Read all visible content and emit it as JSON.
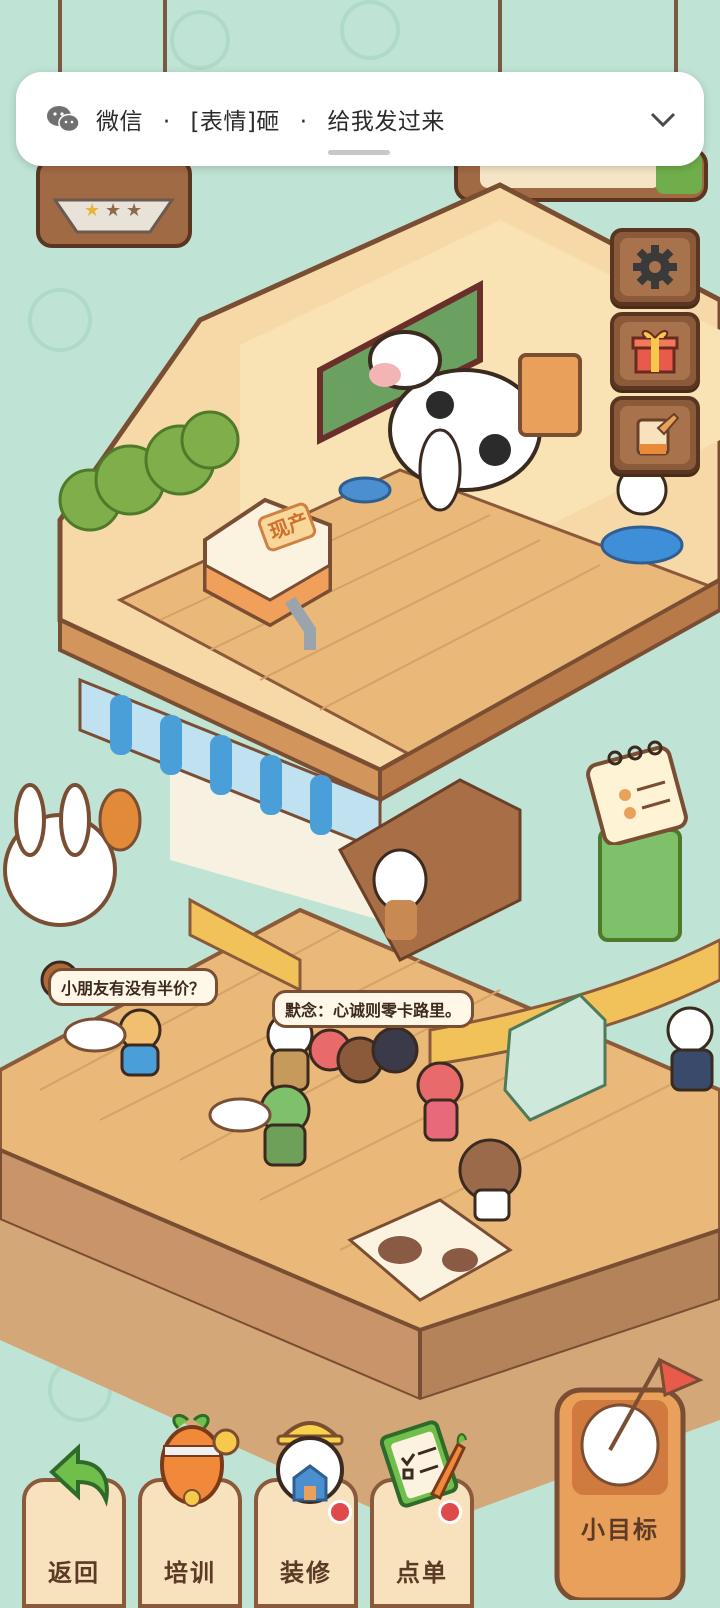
{
  "notification": {
    "app": "微信",
    "separator": "·",
    "sender": "[表情]砸",
    "message": "给我发过来"
  },
  "speech_bubbles": {
    "customer_left": "小朋友有没有半价？",
    "customer_center": "默念：心诚则零卡路里。"
  },
  "signs": {
    "milk_box": "现产"
  },
  "bottom_nav": {
    "back": "返回",
    "train": "培训",
    "decorate": "装修",
    "order": "点单",
    "goal": "小目标"
  },
  "icons": {
    "settings": "gear-icon",
    "gift": "gift-icon",
    "decor": "paintbrush-icon",
    "notes": "calendar-notes-icon"
  },
  "colors": {
    "background": "#bfe3d4",
    "wood": "#e8b982",
    "frame": "#8a5a3a",
    "badge": "#e14a4a"
  }
}
